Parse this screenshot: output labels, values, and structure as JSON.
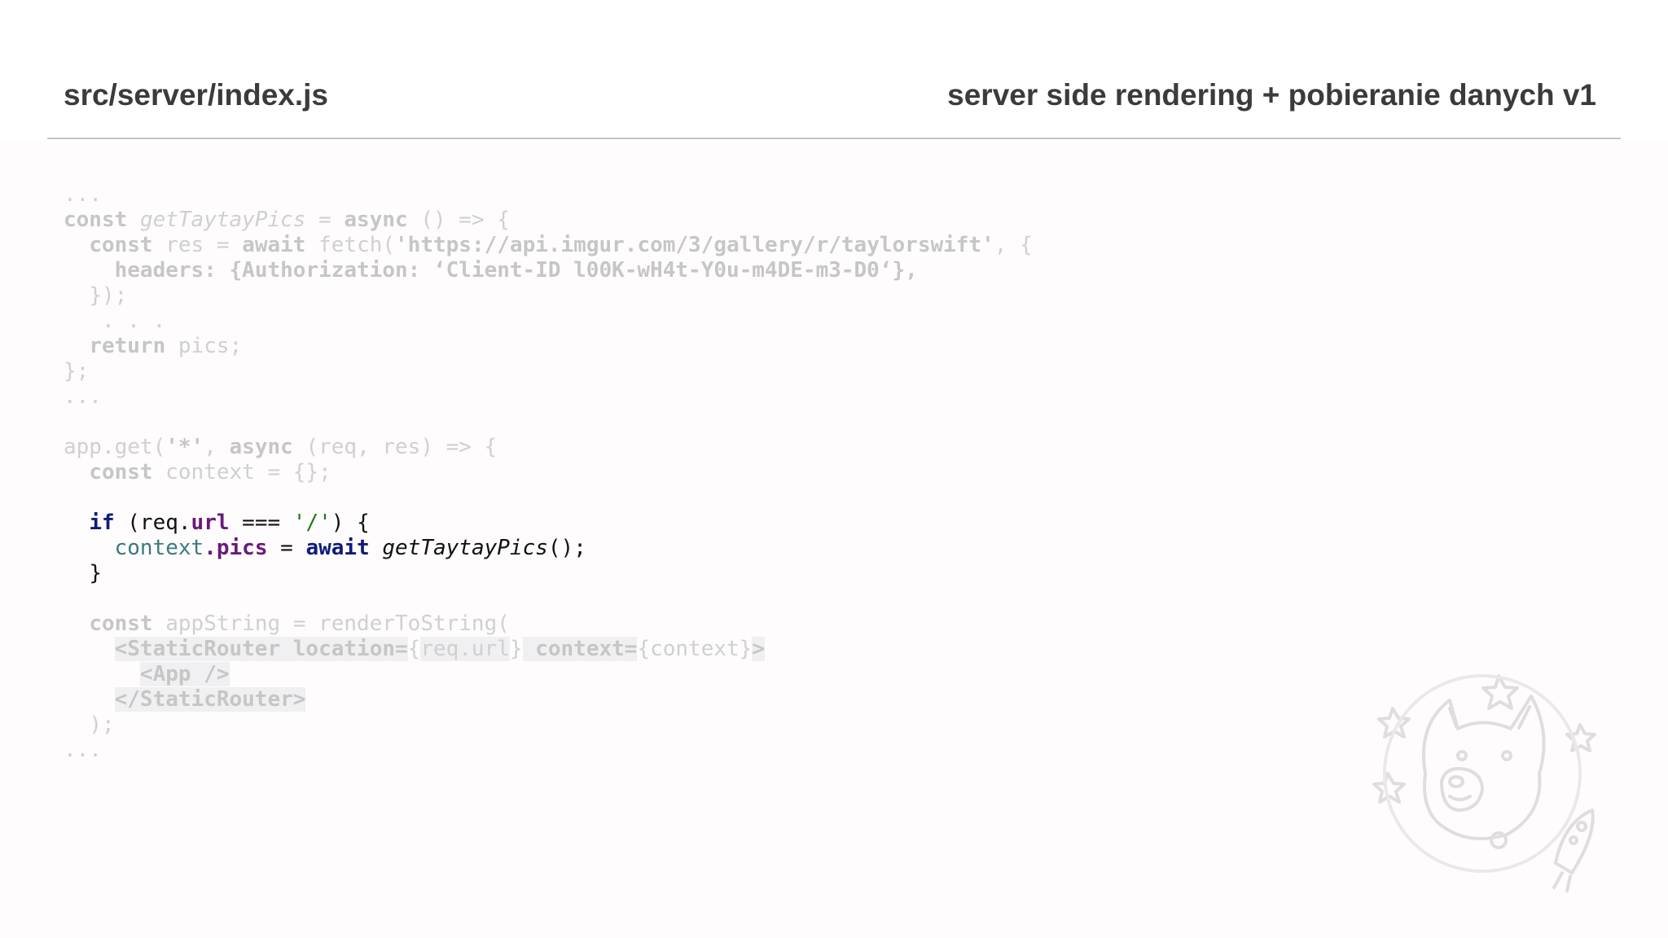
{
  "header": {
    "file_path": "src/server/index.js",
    "slide_title": "server side rendering + pobieranie danych v1"
  },
  "code": {
    "ellipsis_top": "...",
    "l1_kw": "const",
    "l1_fn": "getTaytayPics",
    "l1_eq": " = ",
    "l1_async": "async",
    "l1_rest": " () => {",
    "l2_kw": "const",
    "l2_mid": " res = ",
    "l2_await": "await",
    "l2_fetch": " fetch(",
    "l2_url": "'https://api.imgur.com/3/gallery/r/taylorswift'",
    "l2_end": ", {",
    "l3_key": "headers: ",
    "l3_val": "{Authorization: ‘Client-ID l00K-wH4t-Y0u-m4DE-m3-D0‘},",
    "l4": "});",
    "l5": ". . .",
    "l6_kw": "return",
    "l6_rest": " pics;",
    "l7": "};",
    "ellipsis_mid": "...",
    "l9_pre": "app.get(",
    "l9_str": "'*'",
    "l9_comma": ", ",
    "l9_async": "async",
    "l9_rest": " (req, res) => {",
    "l10_kw": "const",
    "l10_rest": " context = {};",
    "if_kw": "if",
    "if_open": " (req.",
    "if_prop": "url",
    "if_eq": " === ",
    "if_str": "'/'",
    "if_close": ") {",
    "ctx_obj": "context",
    "ctx_dot": ".",
    "ctx_prop": "pics",
    "ctx_eq": " = ",
    "ctx_await": "await",
    "ctx_fn": "getTaytayPics",
    "ctx_call": "();",
    "close_brace": "}",
    "l15_kw": "const",
    "l15_rest": " appString = renderToString(",
    "l16_tag": "<StaticRouter location=",
    "l16_b1": "{",
    "l16_v1": "req.url",
    "l16_b2": "}",
    "l16_ctx": " context=",
    "l16_v2": "{context}",
    "l16_end": ">",
    "l17": "<App />",
    "l18": "</StaticRouter>",
    "l19": ");",
    "ellipsis_end": "..."
  },
  "decoration": {
    "icon": "doge-astronaut-icon"
  }
}
